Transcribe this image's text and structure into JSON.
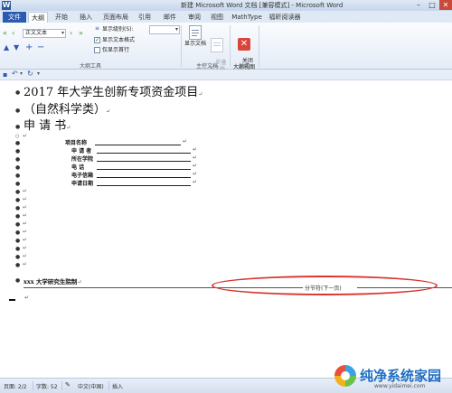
{
  "window": {
    "title": "新建 Microsoft Word 文档 [兼容模式] - Microsoft Word",
    "app_icon_letter": "W",
    "controls": [
      "–",
      "□",
      "✕"
    ]
  },
  "ribbon_tabs": {
    "file": "文件",
    "tabs": [
      "大纲",
      "开始",
      "插入",
      "页面布局",
      "引用",
      "邮件",
      "审阅",
      "视图",
      "MathType",
      "福昕阅读器"
    ],
    "active": "大纲"
  },
  "outline_tools": {
    "level_select": "正文文本",
    "show_level_label": "显示级别(S):",
    "show_level_value": "",
    "show_text_format": "显示文本格式",
    "show_text_format_checked": true,
    "show_first_line_only": "仅显示首行",
    "show_first_line_only_checked": false,
    "group_label": "大纲工具"
  },
  "master_document": {
    "show_document": "显示文档",
    "collapse_subdocs": "折叠\n子文档",
    "group_label": "主控文档"
  },
  "close_group": {
    "close_outline": "关闭\n大纲视图",
    "group_label": "关闭"
  },
  "document": {
    "heading1": "2017 年大学生创新专项资金项目",
    "heading2": "（自然科学类）",
    "heading3": "申    请    书",
    "fields": [
      {
        "label": "项目名称"
      },
      {
        "label": "申  请  者"
      },
      {
        "label": "所在学院"
      },
      {
        "label": "电      话"
      },
      {
        "label": "电子信箱"
      },
      {
        "label": "申请日期"
      }
    ],
    "para_mark": "↵",
    "footer_line": "xxx 大学研究生院制",
    "section_break": "分节符(下一页)"
  },
  "statusbar": {
    "page": "页面: 2/2",
    "words": "字数: 52",
    "language": "中文(中国)",
    "mode": "插入"
  },
  "watermark": {
    "title": "纯净系统家园",
    "url": "www.yidaimei.com"
  },
  "colors": {
    "accent": "#2a5bb0",
    "highlight_oval": "#d8342c"
  }
}
